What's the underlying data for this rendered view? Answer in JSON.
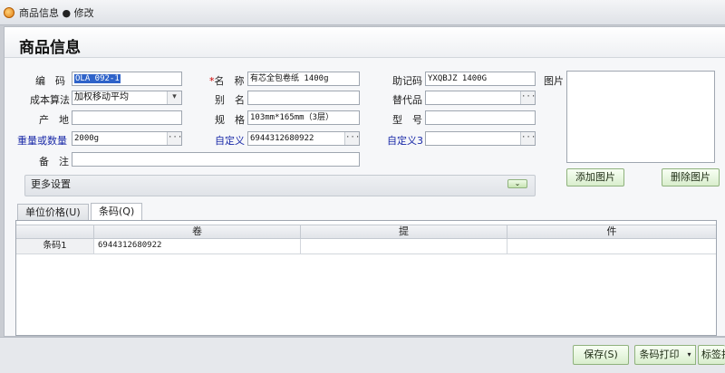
{
  "titlebar": {
    "text": "商品信息 ● 修改"
  },
  "panel": {
    "title": "商品信息"
  },
  "labels": {
    "code": "编　码",
    "name_req": "*",
    "name": "名　称",
    "mnemonic": "助记码",
    "picture": "图片",
    "cost_method": "成本算法",
    "alias": "别　名",
    "substitute": "替代品",
    "origin": "产　地",
    "spec": "规　格",
    "model": "型　号",
    "weight": "重量或数量",
    "custom": "自定义",
    "custom3": "自定义3",
    "remark": "备　注"
  },
  "fields": {
    "code": "OLA 092-1",
    "name": "有芯全包卷纸 1400g",
    "mnemonic": "YXQBJZ 1400G",
    "cost_method": "加权移动平均",
    "alias": "",
    "substitute": "",
    "origin": "",
    "spec": "103mm*165mm（3层）",
    "model": "",
    "weight": "2000g",
    "custom": "6944312680922",
    "custom3": "",
    "remark": ""
  },
  "buttons": {
    "add_image": "添加图片",
    "delete_image": "删除图片",
    "save": "保存(S)",
    "barcode_print": "条码打印",
    "label_print": "标签打印"
  },
  "more_settings": {
    "label": "更多设置"
  },
  "tabs": [
    {
      "label": "单位价格(U)"
    },
    {
      "label": "条码(Q)"
    }
  ],
  "grid": {
    "columns": [
      "卷",
      "提",
      "件"
    ],
    "rows": [
      {
        "label": "条码1",
        "values": [
          "6944312680922",
          "",
          ""
        ]
      }
    ]
  },
  "icons": {
    "ellipsis": "···",
    "dropdown": "▾",
    "expand": "⌄"
  },
  "colors": {
    "button_green": "#d9eecd",
    "label_blue": "#1a2aa8",
    "selection": "#2f63c9"
  }
}
